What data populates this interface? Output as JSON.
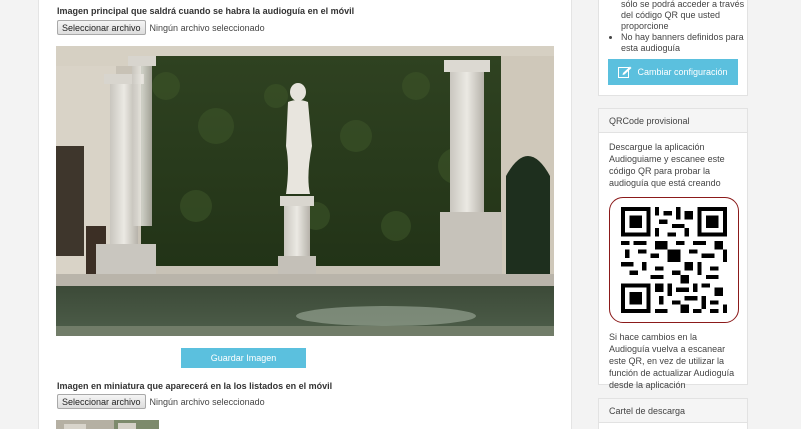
{
  "main": {
    "main_image_label": "Imagen principal que saldrá cuando se habra la audioguía en el móvil",
    "file_button": "Seleccionar archivo",
    "no_file": "Ningún archivo seleccionado",
    "save_image_button": "Guardar Imagen",
    "thumbnail_label": "Imagen en miniatura que aparecerá en la los listados en el móvil"
  },
  "sidebar": {
    "features_continuation": "sólo se podrá acceder a través del código QR que usted proporcione",
    "features_item": "No hay banners definidos para esta audioguía",
    "config_button": "Cambiar configuración",
    "qr_card_title": "QRCode provisional",
    "qr_instructions": "Descargue la aplicación Audioguiame y escanee este código QR para probar la audioguía que está creando",
    "qr_note": "Si hace cambios en la Audioguía vuelva a escanear este QR, en vez de utilizar la función de actualizar Audioguía desde la aplicación",
    "download_card_title": "Cartel de descarga"
  },
  "colors": {
    "accent": "#5bc0de",
    "qr_border": "#8b1a1a"
  },
  "icons": {
    "config": "edit-icon"
  }
}
